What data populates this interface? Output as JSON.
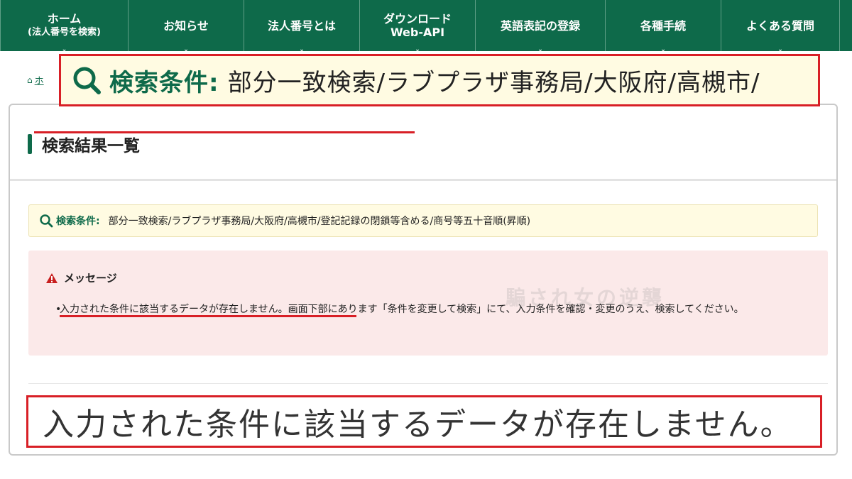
{
  "nav": {
    "items": [
      {
        "label": "ホーム",
        "sub": "(法人番号を検索)"
      },
      {
        "label": "お知らせ",
        "sub": ""
      },
      {
        "label": "法人番号とは",
        "sub": ""
      },
      {
        "label": "ダウンロード",
        "sub": "Web-API"
      },
      {
        "label": "英語表記の登録",
        "sub": ""
      },
      {
        "label": "各種手続",
        "sub": ""
      },
      {
        "label": "よくある質問",
        "sub": ""
      }
    ],
    "caret": "⌄",
    "bg_color": "#0e6a4a"
  },
  "breadcrumb": {
    "home_link": "ホ"
  },
  "zoom_top": {
    "label": "検索条件:",
    "value": "部分一致検索/ラブプラザ事務局/大阪府/高槻市/"
  },
  "card": {
    "title": "検索結果一覧",
    "condition": {
      "label": "検索条件:",
      "value": "部分一致検索/ラブプラザ事務局/大阪府/高槻市/登記記録の閉鎖等含める/商号等五十音順(昇順)"
    },
    "message": {
      "title": "メッセージ",
      "bullet": "•",
      "text_em": "入力された条件に該当するデータが存在しません。",
      "text_rest": "画面下部にあります「条件を変更して検索」にて、入力条件を確認・変更のうえ、検索してください。"
    }
  },
  "zoom_bottom": {
    "value": "入力された条件に該当するデータが存在しません。"
  },
  "watermark": "騙され女の逆襲",
  "colors": {
    "accent": "#0e6a4a",
    "highlight_red": "#d81f26",
    "condition_bg": "#fffbe2",
    "message_bg": "#fbe9e9"
  }
}
